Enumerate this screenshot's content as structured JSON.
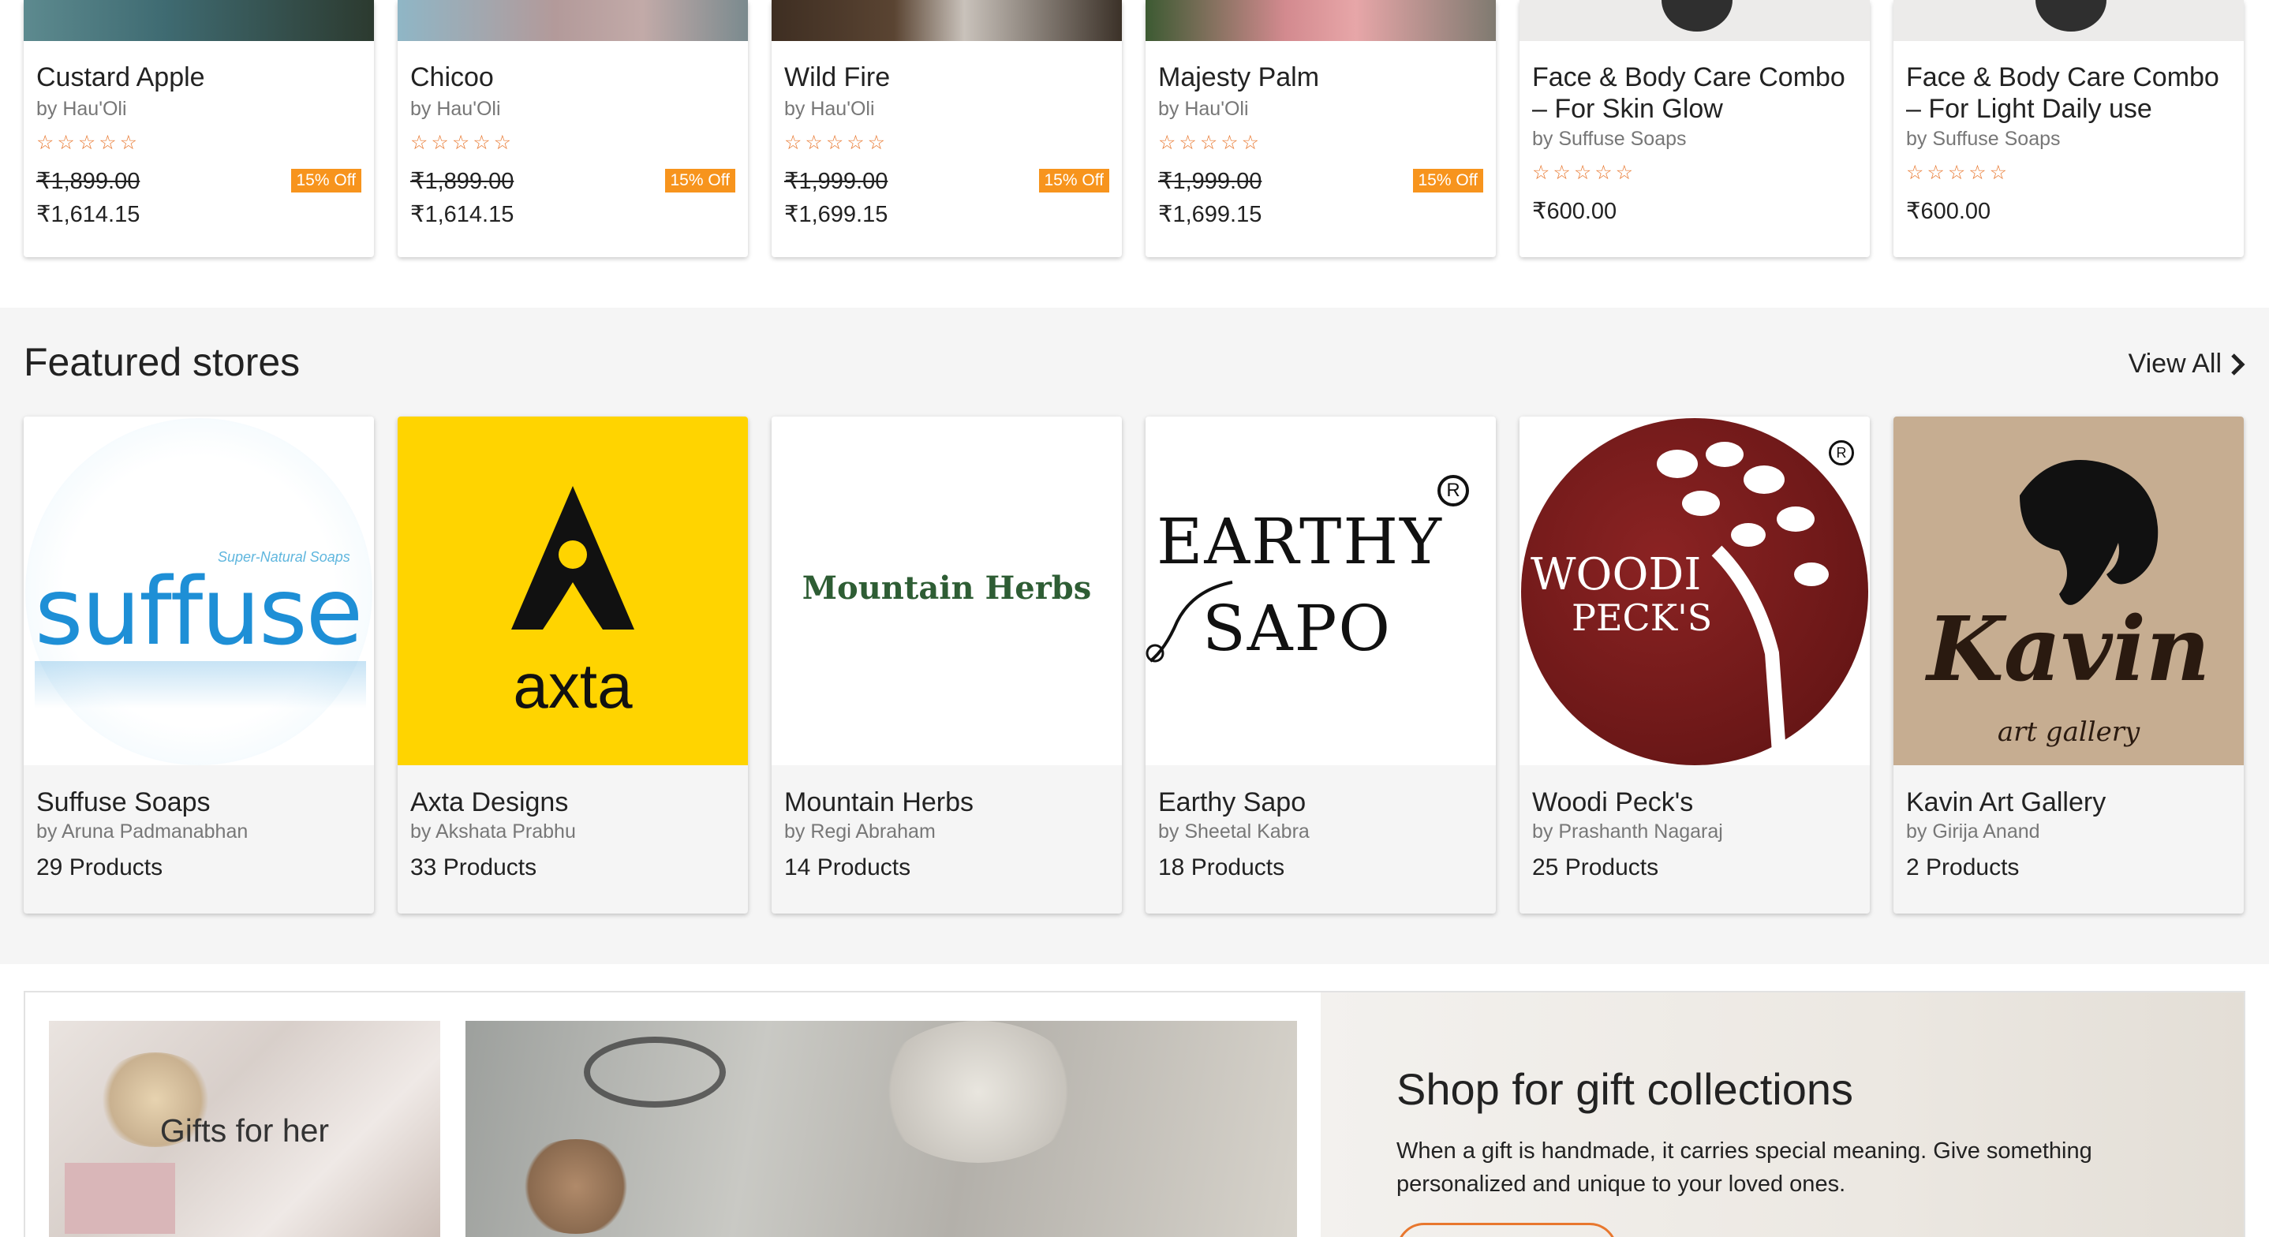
{
  "products": [
    {
      "name_line1": "Custard Apple",
      "name_line2": "",
      "seller": "by Hau'Oli",
      "stars": "☆☆☆☆☆",
      "mrp": "₹1,899.00",
      "price": "₹1,614.15",
      "discount": "15% Off"
    },
    {
      "name_line1": "Chicoo",
      "name_line2": "",
      "seller": "by Hau'Oli",
      "stars": "☆☆☆☆☆",
      "mrp": "₹1,899.00",
      "price": "₹1,614.15",
      "discount": "15% Off"
    },
    {
      "name_line1": "Wild Fire",
      "name_line2": "",
      "seller": "by Hau'Oli",
      "stars": "☆☆☆☆☆",
      "mrp": "₹1,999.00",
      "price": "₹1,699.15",
      "discount": "15% Off"
    },
    {
      "name_line1": "Majesty Palm",
      "name_line2": "",
      "seller": "by Hau'Oli",
      "stars": "☆☆☆☆☆",
      "mrp": "₹1,999.00",
      "price": "₹1,699.15",
      "discount": "15% Off"
    },
    {
      "name_line1": "Face & Body Care Combo",
      "name_line2": "– For Skin Glow",
      "seller": "by Suffuse Soaps",
      "stars": "☆☆☆☆☆",
      "mrp": "",
      "price": "₹600.00",
      "discount": ""
    },
    {
      "name_line1": "Face & Body Care Combo",
      "name_line2": "– For Light Daily use",
      "seller": "by Suffuse Soaps",
      "stars": "☆☆☆☆☆",
      "mrp": "",
      "price": "₹600.00",
      "discount": ""
    }
  ],
  "featured": {
    "title": "Featured stores",
    "view_all": "View All",
    "stores": [
      {
        "name": "Suffuse Soaps",
        "owner": "by Aruna Padmanabhan",
        "count": "29 Products",
        "logo_text": "suffuse",
        "logo_sub": "Super-Natural Soaps"
      },
      {
        "name": "Axta Designs",
        "owner": "by Akshata Prabhu",
        "count": "33 Products",
        "logo_text": "axta",
        "logo_sub": "A"
      },
      {
        "name": "Mountain Herbs",
        "owner": "by Regi Abraham",
        "count": "14 Products",
        "logo_text": "Mountain Herbs",
        "logo_sub": ""
      },
      {
        "name": "Earthy Sapo",
        "owner": "by Sheetal Kabra",
        "count": "18 Products",
        "logo_text": "EARTHY",
        "logo_sub": "SAPO"
      },
      {
        "name": "Woodi Peck's",
        "owner": "by Prashanth Nagaraj",
        "count": "25 Products",
        "logo_text": "WOODI",
        "logo_sub": "PECK'S"
      },
      {
        "name": "Kavin Art Gallery",
        "owner": "by Girija Anand",
        "count": "2 Products",
        "logo_text": "Kavin",
        "logo_sub": "art gallery"
      }
    ]
  },
  "gifts": {
    "her_label": "Gifts for her",
    "title": "Shop for gift collections",
    "description": "When a gift is handmade, it carries special meaning. Give something personalized and unique to your loved ones."
  },
  "colors": {
    "accent": "#e8772e",
    "badge": "#f7941d",
    "section_bg": "#f5f5f5",
    "woodi": "#7a1d1d",
    "axta": "#ffd400",
    "kavin_bg": "#c6ad91",
    "herbs": "#2e5d34"
  }
}
